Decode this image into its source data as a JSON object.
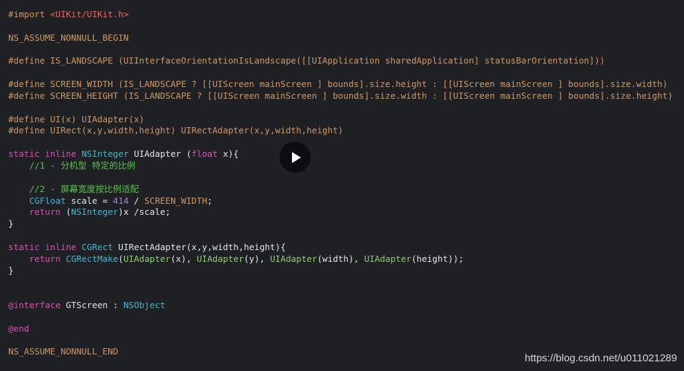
{
  "code": {
    "import_kw": "#import",
    "import_path": "<UIKit/UIKit.h>",
    "assume_begin": "NS_ASSUME_NONNULL_BEGIN",
    "landscape_define": "#define IS_LANDSCAPE (UIInterfaceOrientationIsLandscape([[UIApplication sharedApplication] statusBarOrientation]))",
    "screen_width_define": "#define SCREEN_WIDTH (IS_LANDSCAPE ? [[UIScreen mainScreen ] bounds].size.height : [[UIScreen mainScreen ] bounds].size.width)",
    "screen_height_define": "#define SCREEN_HEIGHT (IS_LANDSCAPE ? [[UIScreen mainScreen ] bounds].size.width : [[UIScreen mainScreen ] bounds].size.height)",
    "ui_define": "#define UI(x) UIAdapter(x)",
    "uirect_define": "#define UIRect(x,y,width,height) UIRectAdapter(x,y,width,height)",
    "fn1_static": "static",
    "fn1_inline": "inline",
    "fn1_type": "NSInteger",
    "fn1_sig": " UIAdapter (",
    "fn1_param_type": "float",
    "fn1_sig_end": " x){",
    "fn1_comment1": "    //1 - 分机型 特定的比例",
    "fn1_comment2": "    //2 - 屏幕宽度按比例适配",
    "fn1_line3_type": "CGFloat",
    "fn1_line3_mid": " scale = ",
    "fn1_line3_num": "414",
    "fn1_line3_slash": " / ",
    "fn1_line3_macro": "SCREEN_WIDTH",
    "fn1_line3_end": ";",
    "fn1_return": "return",
    "fn1_return_open": " (",
    "fn1_return_type": "NSInteger",
    "fn1_return_end": ")x /scale;",
    "close_brace": "}",
    "fn2_static": "static",
    "fn2_inline": "inline",
    "fn2_type": "CGRect",
    "fn2_sig": " UIRectAdapter(x,y,width,height){",
    "fn2_return": "return",
    "fn2_make": "CGRectMake",
    "fn2_arg_fn": "UIAdapter",
    "fn2_arg1": "(x), ",
    "fn2_arg2": "(y), ",
    "fn2_arg3": "(width), ",
    "fn2_arg4": "(height));",
    "open_paren": "(",
    "interface_kw": "@interface",
    "interface_name": " GTScreen : ",
    "interface_super": "NSObject",
    "end_kw": "@end",
    "assume_end": "NS_ASSUME_NONNULL_END"
  },
  "overlay": {
    "play_icon": "play-icon",
    "watermark": "https://blog.csdn.net/u011021289"
  },
  "colors": {
    "background": "#1f2024",
    "preprocessor": "#d19762",
    "string": "#fc5f5a",
    "keyword": "#dc4eb4",
    "type": "#3bb8d3",
    "function": "#8fcc6c",
    "comment": "#57c04c",
    "number": "#a47fdf"
  }
}
